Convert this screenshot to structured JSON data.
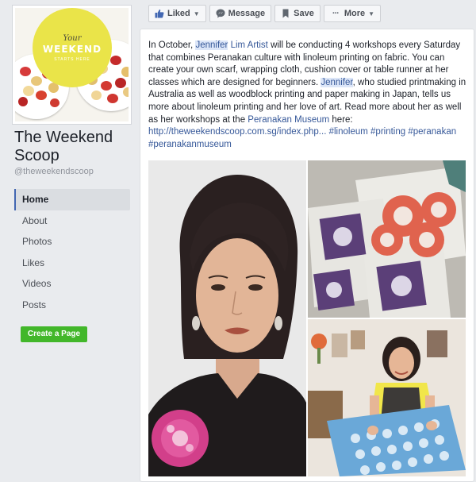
{
  "page": {
    "name": "The Weekend Scoop",
    "handle": "@theweekendscoop",
    "logo": {
      "line1": "Your",
      "line2": "WEEKEND",
      "line3": "STARTS HERE"
    }
  },
  "nav": {
    "items": [
      "Home",
      "About",
      "Photos",
      "Likes",
      "Videos",
      "Posts"
    ],
    "active": "Home"
  },
  "create_page_label": "Create a Page",
  "toolbar": {
    "liked": "Liked",
    "message": "Message",
    "save": "Save",
    "more": "More"
  },
  "post": {
    "t1": "In October, ",
    "hl1": "Jennifer",
    "t2": " ",
    "lk1": "Lim Artist",
    "t3": " will be conducting 4 workshops every Saturday that combines Peranakan culture with linoleum printing on fabric. You can create your own scarf, wrapping cloth, cushion cover or table runner at her classes which are designed for beginners. ",
    "hl2": "Jennifer",
    "t4": ", who studied printmaking in Australia as well as woodblock printing and paper making in Japan, tells us more about linoleum printing and her love of art. Read more about her as well as her workshops at the ",
    "lk2": "Peranakan Museum",
    "t5": " here: ",
    "lk3": "http://theweekendscoop.com.sg/index.php...",
    "t6": " ",
    "lk4": "#linoleum",
    "t7": " ",
    "lk5": "#printing",
    "t8": " ",
    "lk6": "#peranakan",
    "t9": " ",
    "lk7": "#peranakanmuseum"
  },
  "colors": {
    "fb_blue": "#4267b2",
    "link": "#365899",
    "green": "#42b72a",
    "logo_yellow": "#eae449"
  }
}
